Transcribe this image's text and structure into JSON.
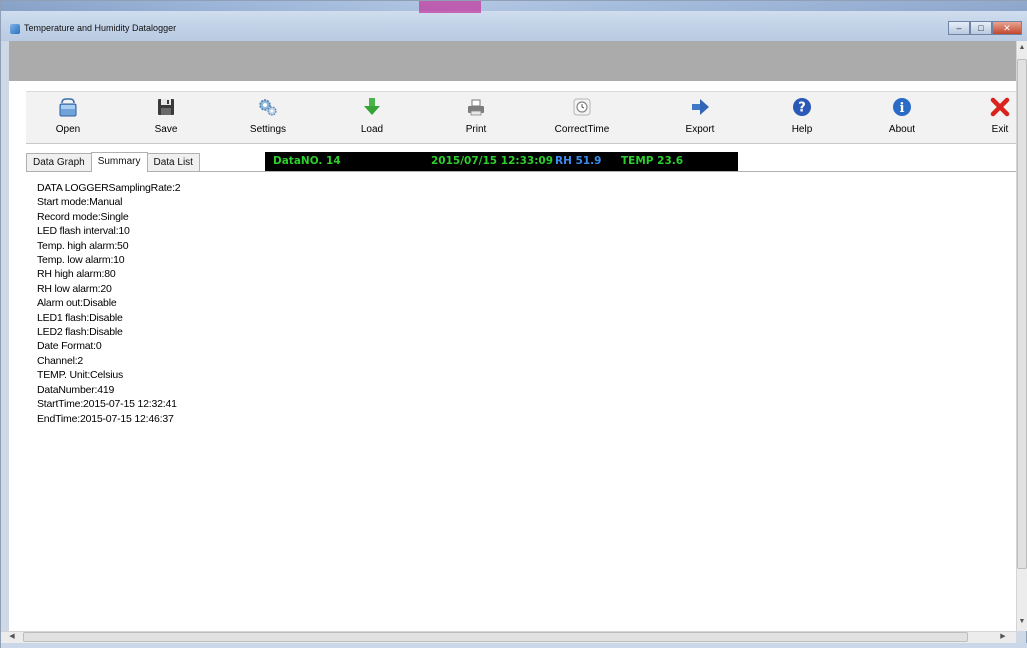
{
  "window": {
    "title": "Temperature and Humidity Datalogger",
    "minimize_glyph": "–",
    "maximize_glyph": "□",
    "close_glyph": "✕"
  },
  "toolbar": {
    "buttons": [
      {
        "label": "Open",
        "icon": "folder-open-icon"
      },
      {
        "label": "Save",
        "icon": "floppy-disk-icon"
      },
      {
        "label": "Settings",
        "icon": "gears-icon"
      },
      {
        "label": "Load",
        "icon": "download-arrow-icon"
      },
      {
        "label": "Print",
        "icon": "printer-icon"
      },
      {
        "label": "CorrectTime",
        "icon": "clock-icon"
      },
      {
        "label": "Export",
        "icon": "right-arrow-icon"
      },
      {
        "label": "Help",
        "icon": "help-icon"
      },
      {
        "label": "About",
        "icon": "info-icon"
      },
      {
        "label": "Exit",
        "icon": "red-x-icon"
      }
    ]
  },
  "tabs": [
    {
      "label": "Data Graph"
    },
    {
      "label": "Summary",
      "active": true
    },
    {
      "label": "Data List"
    }
  ],
  "status": {
    "data_no": "DataNO. 14",
    "datetime": "2015/07/15 12:33:09",
    "rh": "RH 51.9",
    "temp": "TEMP 23.6"
  },
  "summary": [
    "DATA LOGGERSamplingRate:2",
    "Start mode:Manual",
    "Record mode:Single",
    "LED flash interval:10",
    "Temp. high alarm:50",
    "Temp. low alarm:10",
    "RH high alarm:80",
    "RH low alarm:20",
    "Alarm out:Disable",
    "LED1 flash:Disable",
    "LED2 flash:Disable",
    "Date Format:0",
    "Channel:2",
    "TEMP. Unit:Celsius",
    "DataNumber:419",
    "StartTime:2015-07-15 12:32:41",
    "EndTime:2015-07-15  12:46:37"
  ],
  "colors": {
    "status_green": "#2ccf2c",
    "status_blue": "#3b8cf0",
    "status_background": "#000000"
  }
}
